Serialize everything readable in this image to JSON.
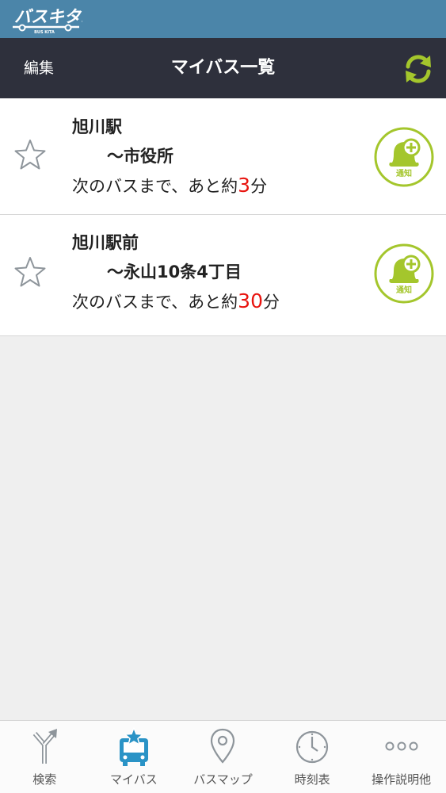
{
  "app": {
    "logo_text": "バスキタ!",
    "logo_subtext": "BUS KITA"
  },
  "nav": {
    "edit_label": "編集",
    "title": "マイバス一覧"
  },
  "colors": {
    "banner": "#4b85a9",
    "nav_bar": "#2e303c",
    "accent_green": "#a4c62c",
    "minutes_red": "#e8140f",
    "tab_active": "#2a93c6"
  },
  "items": [
    {
      "from": "旭川駅",
      "to": "〜市役所",
      "next_prefix": "次のバスまで、あと約",
      "minutes": "3",
      "unit": "分",
      "notify_label": "通知"
    },
    {
      "from": "旭川駅前",
      "to": "〜永山10条4丁目",
      "next_prefix": "次のバスまで、あと約",
      "minutes": "30",
      "unit": "分",
      "notify_label": "通知"
    }
  ],
  "tabs": [
    {
      "label": "検索",
      "icon": "route-split-icon"
    },
    {
      "label": "マイバス",
      "icon": "bus-star-icon",
      "active": true
    },
    {
      "label": "バスマップ",
      "icon": "map-pin-icon"
    },
    {
      "label": "時刻表",
      "icon": "clock-icon"
    },
    {
      "label": "操作説明他",
      "icon": "more-dots-icon"
    }
  ]
}
